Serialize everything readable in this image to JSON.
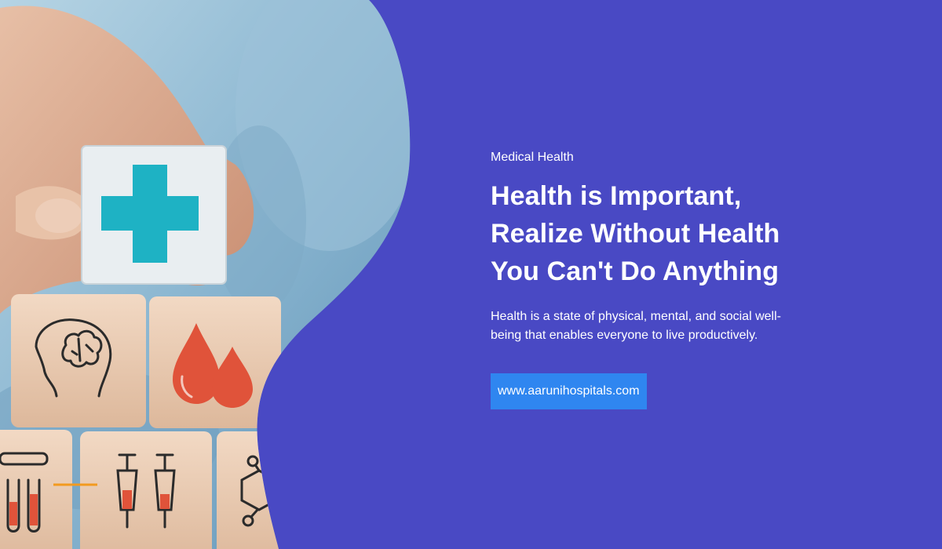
{
  "banner": {
    "kicker": "Medical Health",
    "headline_lines": [
      "Health is Important,",
      "Realize Without Health",
      "You Can't Do Anything"
    ],
    "description_lines": [
      "Health is a state of physical, mental, and social well-",
      "being that enables everyone to live productively."
    ],
    "website_label": "www.aarunihospitals.com"
  },
  "colors": {
    "background": "#4949C4",
    "button": "#2F86F0",
    "cross": "#1EB2C4",
    "blood_drop": "#E0533A",
    "accent_line": "#F29A1F"
  },
  "icons": [
    "medical-cross-icon",
    "brain-head-icon",
    "blood-drop-icon",
    "test-tube-icon",
    "syringe-icon",
    "molecule-icon"
  ]
}
